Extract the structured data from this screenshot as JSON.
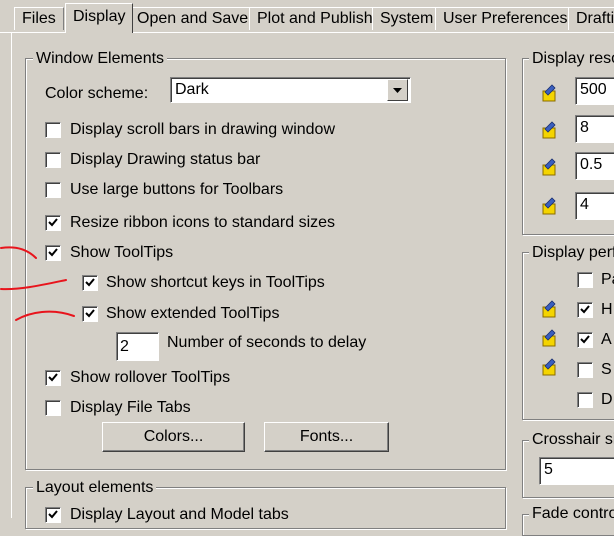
{
  "tabs": [
    "Files",
    "Display",
    "Open and Save",
    "Plot and Publish",
    "System",
    "User Preferences",
    "Drafti"
  ],
  "window_elements": {
    "title": "Window Elements",
    "color_scheme_label": "Color scheme:",
    "color_scheme_value": "Dark",
    "checkboxes": [
      {
        "label": "Display scroll bars in drawing window",
        "checked": false
      },
      {
        "label": "Display Drawing status bar",
        "checked": false
      },
      {
        "label": "Use large buttons for Toolbars",
        "checked": false
      },
      {
        "label": "Resize ribbon icons to standard sizes",
        "checked": true
      },
      {
        "label": "Show ToolTips",
        "checked": true
      },
      {
        "label": "Show shortcut keys in ToolTips",
        "checked": true
      },
      {
        "label": "Show extended ToolTips",
        "checked": true
      },
      {
        "label": "Show rollover ToolTips",
        "checked": true
      },
      {
        "label": "Display File Tabs",
        "checked": false
      }
    ],
    "delay_value": "2",
    "delay_label": "Number of seconds to delay",
    "colors_button": "Colors...",
    "fonts_button": "Fonts..."
  },
  "layout_elements": {
    "title": "Layout elements",
    "first_item": {
      "label": "Display Layout and Model tabs",
      "checked": true
    }
  },
  "display_resolution": {
    "title": "Display reso",
    "values": [
      "500",
      "8",
      "0.5",
      "4"
    ]
  },
  "display_performance": {
    "title": "Display perf",
    "items": [
      {
        "label": "Pa",
        "checked": false,
        "icon": false
      },
      {
        "label": "H",
        "checked": true,
        "icon": true
      },
      {
        "label": "A",
        "checked": true,
        "icon": true
      },
      {
        "label": "S",
        "checked": false,
        "icon": true
      },
      {
        "label": "D",
        "checked": false,
        "icon": false
      }
    ]
  },
  "crosshair": {
    "title": "Crosshair si",
    "value": "5"
  },
  "fade_control": {
    "title": "Fade contro"
  },
  "colors": {
    "background": "#d4d0c8",
    "annotation": "#e8141c"
  }
}
